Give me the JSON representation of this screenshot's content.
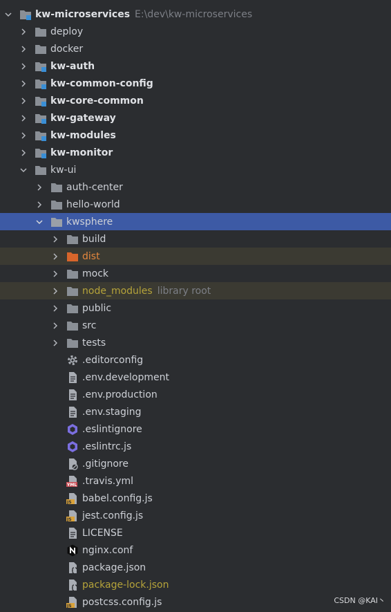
{
  "project": {
    "name": "kw-microservices",
    "path": "E:\\dev\\kw-microservices"
  },
  "folders_top": {
    "deploy": "deploy",
    "docker": "docker",
    "kw_auth": "kw-auth",
    "kw_common_config": "kw-common-config",
    "kw_core_common": "kw-core-common",
    "kw_gateway": "kw-gateway",
    "kw_modules": "kw-modules",
    "kw_monitor": "kw-monitor",
    "kw_ui": "kw-ui"
  },
  "kw_ui_children": {
    "auth_center": "auth-center",
    "hello_world": "hello-world",
    "kwsphere": "kwsphere"
  },
  "kwsphere_children": {
    "build": "build",
    "dist": "dist",
    "mock": "mock",
    "node_modules": "node_modules",
    "node_modules_hint": "library root",
    "public": "public",
    "src": "src",
    "tests": "tests"
  },
  "files": {
    "editorconfig": ".editorconfig",
    "env_development": ".env.development",
    "env_production": ".env.production",
    "env_staging": ".env.staging",
    "eslintignore": ".eslintignore",
    "eslintrc": ".eslintrc.js",
    "gitignore": ".gitignore",
    "travis": ".travis.yml",
    "babel_config": "babel.config.js",
    "jest_config": "jest.config.js",
    "license": "LICENSE",
    "nginx_conf": "nginx.conf",
    "package_json": "package.json",
    "package_lock": "package-lock.json",
    "postcss_config": "postcss.config.js"
  },
  "icon_badges": {
    "yml": "YML",
    "js": "JS"
  },
  "watermark": "CSDN @KAI丶",
  "colors": {
    "background": "#2b2d30",
    "selection": "#3d5aa5",
    "excluded_row": "#3b3a32",
    "folder": "#8a8f96",
    "module_badge": "#3a8fd6",
    "excluded_text": "#e4873e",
    "library_text": "#b5a33a"
  }
}
